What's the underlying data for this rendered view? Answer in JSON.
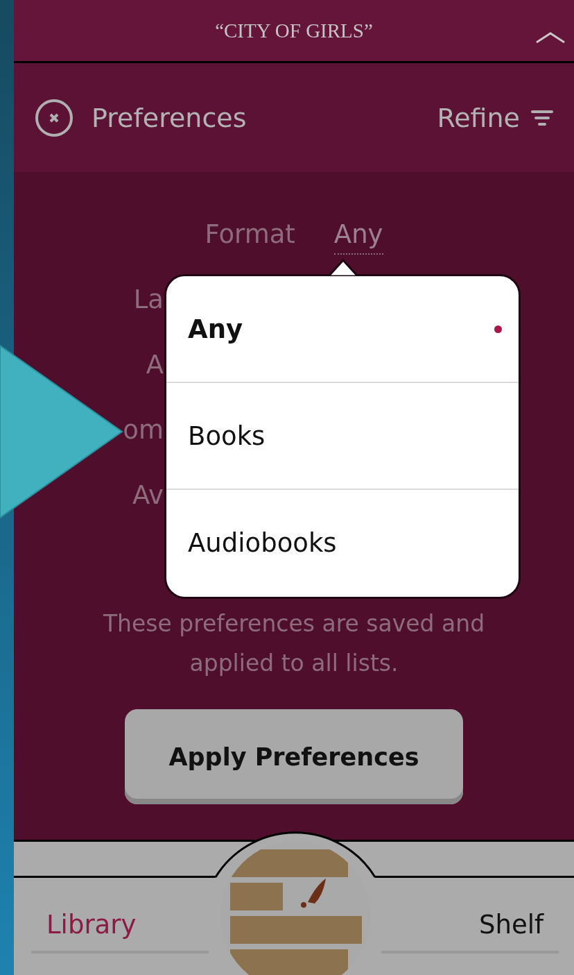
{
  "header": {
    "title": "“CITY OF GIRLS”"
  },
  "toolbar": {
    "title": "Preferences",
    "refine": "Refine"
  },
  "filters": [
    {
      "label": "Format",
      "value": "Any"
    },
    {
      "label": "La"
    },
    {
      "label": "A"
    },
    {
      "label": "om"
    },
    {
      "label": "Av"
    }
  ],
  "popup": {
    "options": [
      {
        "label": "Any",
        "selected": true
      },
      {
        "label": "Books",
        "selected": false
      },
      {
        "label": "Audiobooks",
        "selected": false
      }
    ]
  },
  "note": "These preferences are saved and applied to all lists.",
  "apply_button": "Apply Preferences",
  "tabs": [
    {
      "label": "Library",
      "selected": true
    },
    {
      "label": "Shelf",
      "selected": false
    }
  ]
}
